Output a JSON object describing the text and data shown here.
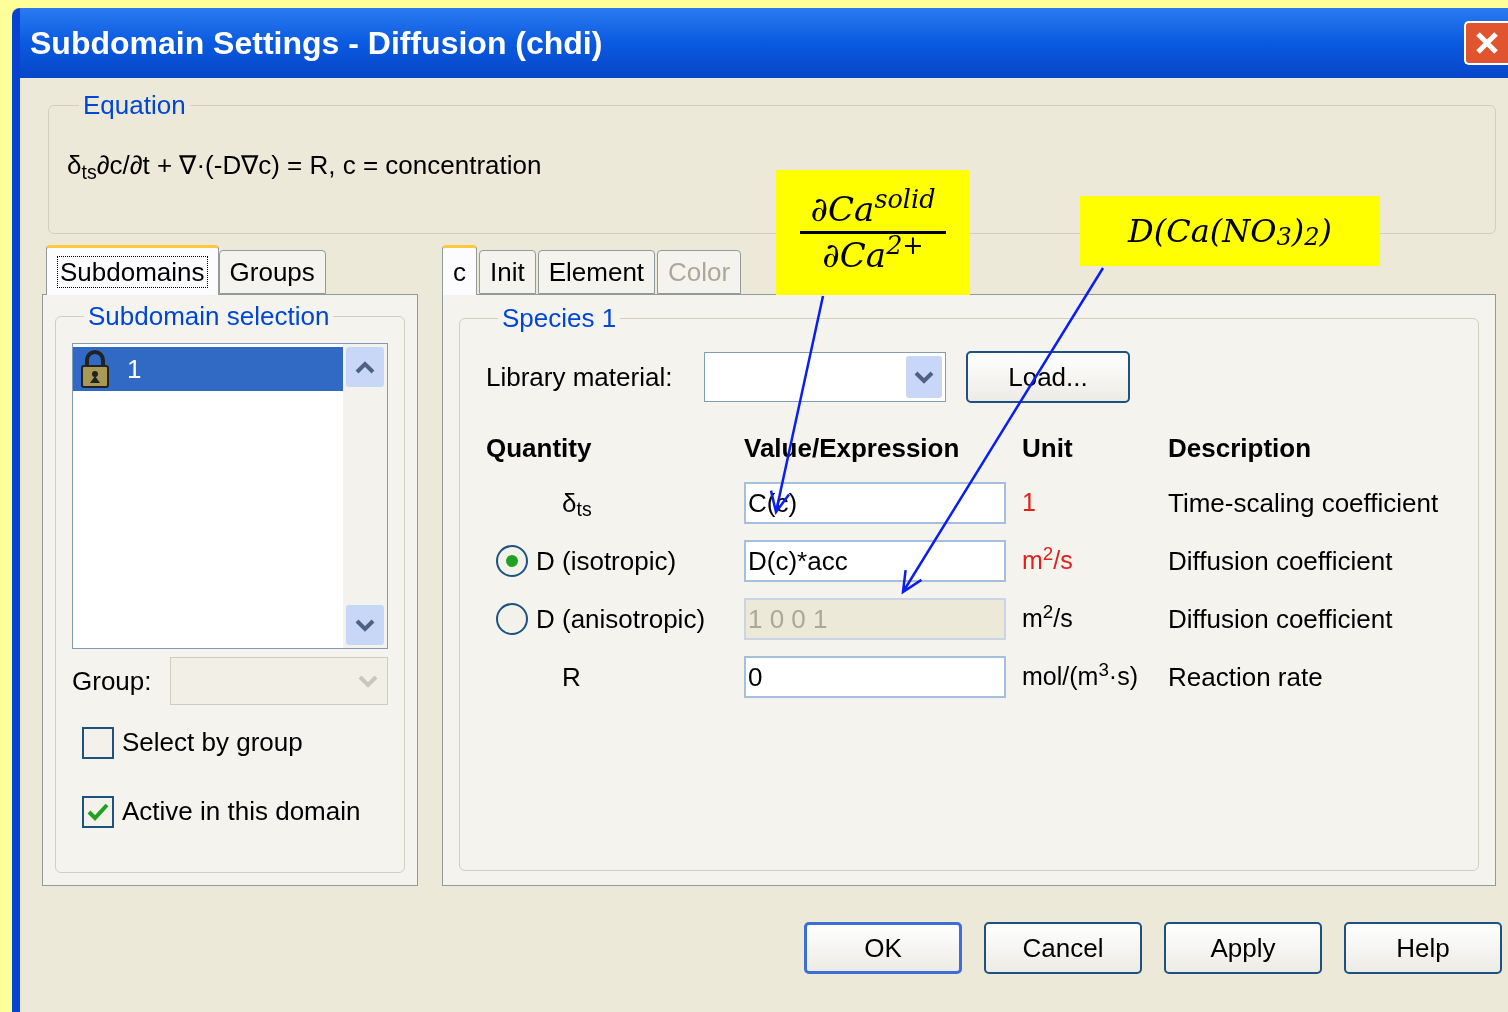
{
  "window": {
    "title": "Subdomain Settings - Diffusion (chdi)"
  },
  "equation": {
    "legend": "Equation",
    "text": "δ$_{ts}$∂c/∂t + ∇·(-D∇c) = R, c = concentration"
  },
  "left_tabs": [
    {
      "label": "Subdomains",
      "selected": true
    },
    {
      "label": "Groups",
      "selected": false
    }
  ],
  "subdomain_selection": {
    "legend": "Subdomain selection",
    "items": [
      {
        "label": "1",
        "selected": true
      }
    ],
    "group_label": "Group:",
    "group_disabled": true
  },
  "options": [
    {
      "label": "Select by group",
      "checked": false
    },
    {
      "label": "Active in this domain",
      "checked": true
    }
  ],
  "right_tabs": [
    {
      "label": "c",
      "selected": true,
      "disabled": false
    },
    {
      "label": "Init",
      "selected": false,
      "disabled": false
    },
    {
      "label": "Element",
      "selected": false,
      "disabled": false
    },
    {
      "label": "Color",
      "selected": false,
      "disabled": true
    }
  ],
  "species": {
    "legend": "Species 1",
    "library_label": "Library material:",
    "load_button": "Load...",
    "columns": [
      "Quantity",
      "Value/Expression",
      "Unit",
      "Description"
    ],
    "rows": [
      {
        "kind": "plain",
        "quantity": "δ$_{ts}$",
        "value": "C(c)",
        "disabled": false,
        "unit": "1",
        "unit_highlighted": true,
        "description": "Time-scaling coefficient"
      },
      {
        "kind": "radio",
        "selected": true,
        "quantity": "D (isotropic)",
        "value": "D(c)*acc",
        "disabled": false,
        "unit": "m$^{2}$/s",
        "unit_highlighted": true,
        "description": "Diffusion coefficient"
      },
      {
        "kind": "radio",
        "selected": false,
        "quantity": "D (anisotropic)",
        "value": "1 0 0 1",
        "disabled": true,
        "unit": "m$^{2}$/s",
        "unit_highlighted": false,
        "description": "Diffusion coefficient"
      },
      {
        "kind": "plain",
        "quantity": "R",
        "value": "0",
        "disabled": false,
        "unit": "mol/(m$^{3}$·s)",
        "unit_highlighted": false,
        "description": "Reaction rate"
      }
    ]
  },
  "buttons": [
    {
      "label": "OK",
      "default": true
    },
    {
      "label": "Cancel",
      "default": false
    },
    {
      "label": "Apply",
      "default": false
    },
    {
      "label": "Help",
      "default": false
    }
  ],
  "annotations": [
    {
      "kind": "fraction",
      "numerator": "∂Ca$^{solid}$",
      "denominator": "∂Ca$^{2+}$"
    },
    {
      "kind": "text",
      "text": "D(Ca(NO$_{3}$)$_{2}$)"
    }
  ]
}
